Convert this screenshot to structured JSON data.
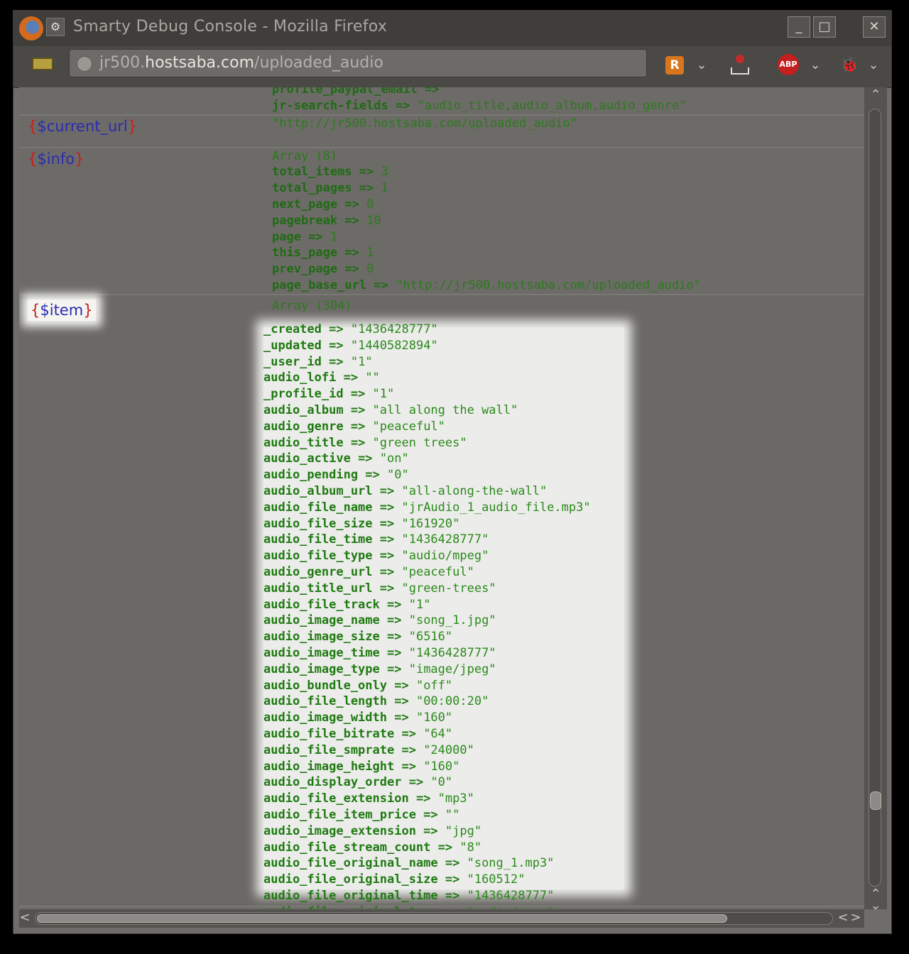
{
  "window": {
    "title": "Smarty Debug Console - Mozilla Firefox",
    "menu_glyph": "⚙",
    "minimize": "_",
    "maximize": "□",
    "close": "✕"
  },
  "navbar": {
    "url_prefix": "jr500.",
    "url_host": "hostsaba.com",
    "url_path": "/uploaded_audio",
    "rss_letter": "R",
    "abp_label": "ABP",
    "chevron": "⌄",
    "firebug_glyph": "🐞"
  },
  "top_partial": [
    {
      "k": "profile_paypal_email",
      "v": "\"\""
    },
    {
      "k": "jr-search-fields",
      "v": "\"audio_title,audio_album,audio_genre\""
    }
  ],
  "current_url": {
    "name": "$current_url",
    "value": "\"http://jr500.hostsaba.com/uploaded_audio\""
  },
  "info": {
    "name": "$info",
    "header": "Array (8)",
    "entries": [
      {
        "k": "total_items",
        "v": "3"
      },
      {
        "k": "total_pages",
        "v": "1"
      },
      {
        "k": "next_page",
        "v": "0"
      },
      {
        "k": "pagebreak",
        "v": "10"
      },
      {
        "k": "page",
        "v": "1"
      },
      {
        "k": "this_page",
        "v": "1"
      },
      {
        "k": "prev_page",
        "v": "0"
      },
      {
        "k": "page_base_url",
        "v": "\"http://jr500.hostsaba.com/uploaded_audio\""
      }
    ]
  },
  "item": {
    "name": "$item",
    "header": "Array (304)",
    "entries": [
      {
        "k": "_created",
        "v": "\"1436428777\""
      },
      {
        "k": "_updated",
        "v": "\"1440582894\""
      },
      {
        "k": "_user_id",
        "v": "\"1\""
      },
      {
        "k": "audio_lofi",
        "v": "\"\""
      },
      {
        "k": "_profile_id",
        "v": "\"1\""
      },
      {
        "k": "audio_album",
        "v": "\"all along the wall\""
      },
      {
        "k": "audio_genre",
        "v": "\"peaceful\""
      },
      {
        "k": "audio_title",
        "v": "\"green trees\""
      },
      {
        "k": "audio_active",
        "v": "\"on\""
      },
      {
        "k": "audio_pending",
        "v": "\"0\""
      },
      {
        "k": "audio_album_url",
        "v": "\"all-along-the-wall\""
      },
      {
        "k": "audio_file_name",
        "v": "\"jrAudio_1_audio_file.mp3\""
      },
      {
        "k": "audio_file_size",
        "v": "\"161920\""
      },
      {
        "k": "audio_file_time",
        "v": "\"1436428777\""
      },
      {
        "k": "audio_file_type",
        "v": "\"audio/mpeg\""
      },
      {
        "k": "audio_genre_url",
        "v": "\"peaceful\""
      },
      {
        "k": "audio_title_url",
        "v": "\"green-trees\""
      },
      {
        "k": "audio_file_track",
        "v": "\"1\""
      },
      {
        "k": "audio_image_name",
        "v": "\"song_1.jpg\""
      },
      {
        "k": "audio_image_size",
        "v": "\"6516\""
      },
      {
        "k": "audio_image_time",
        "v": "\"1436428777\""
      },
      {
        "k": "audio_image_type",
        "v": "\"image/jpeg\""
      },
      {
        "k": "audio_bundle_only",
        "v": "\"off\""
      },
      {
        "k": "audio_file_length",
        "v": "\"00:00:20\""
      },
      {
        "k": "audio_image_width",
        "v": "\"160\""
      },
      {
        "k": "audio_file_bitrate",
        "v": "\"64\""
      },
      {
        "k": "audio_file_smprate",
        "v": "\"24000\""
      },
      {
        "k": "audio_image_height",
        "v": "\"160\""
      },
      {
        "k": "audio_display_order",
        "v": "\"0\""
      },
      {
        "k": "audio_file_extension",
        "v": "\"mp3\""
      },
      {
        "k": "audio_file_item_price",
        "v": "\"\""
      },
      {
        "k": "audio_image_extension",
        "v": "\"jpg\""
      },
      {
        "k": "audio_file_stream_count",
        "v": "\"8\""
      },
      {
        "k": "audio_file_original_name",
        "v": "\"song_1.mp3\""
      },
      {
        "k": "audio_file_original_size",
        "v": "\"160512\""
      },
      {
        "k": "audio_file_original_time",
        "v": "\"1436428777\""
      },
      {
        "k": "audio_file_original_type",
        "v": "\"audio/mpeg\""
      }
    ]
  },
  "scroll": {
    "up": "⌃",
    "down": "⌄",
    "left": "<",
    "right": ">"
  }
}
